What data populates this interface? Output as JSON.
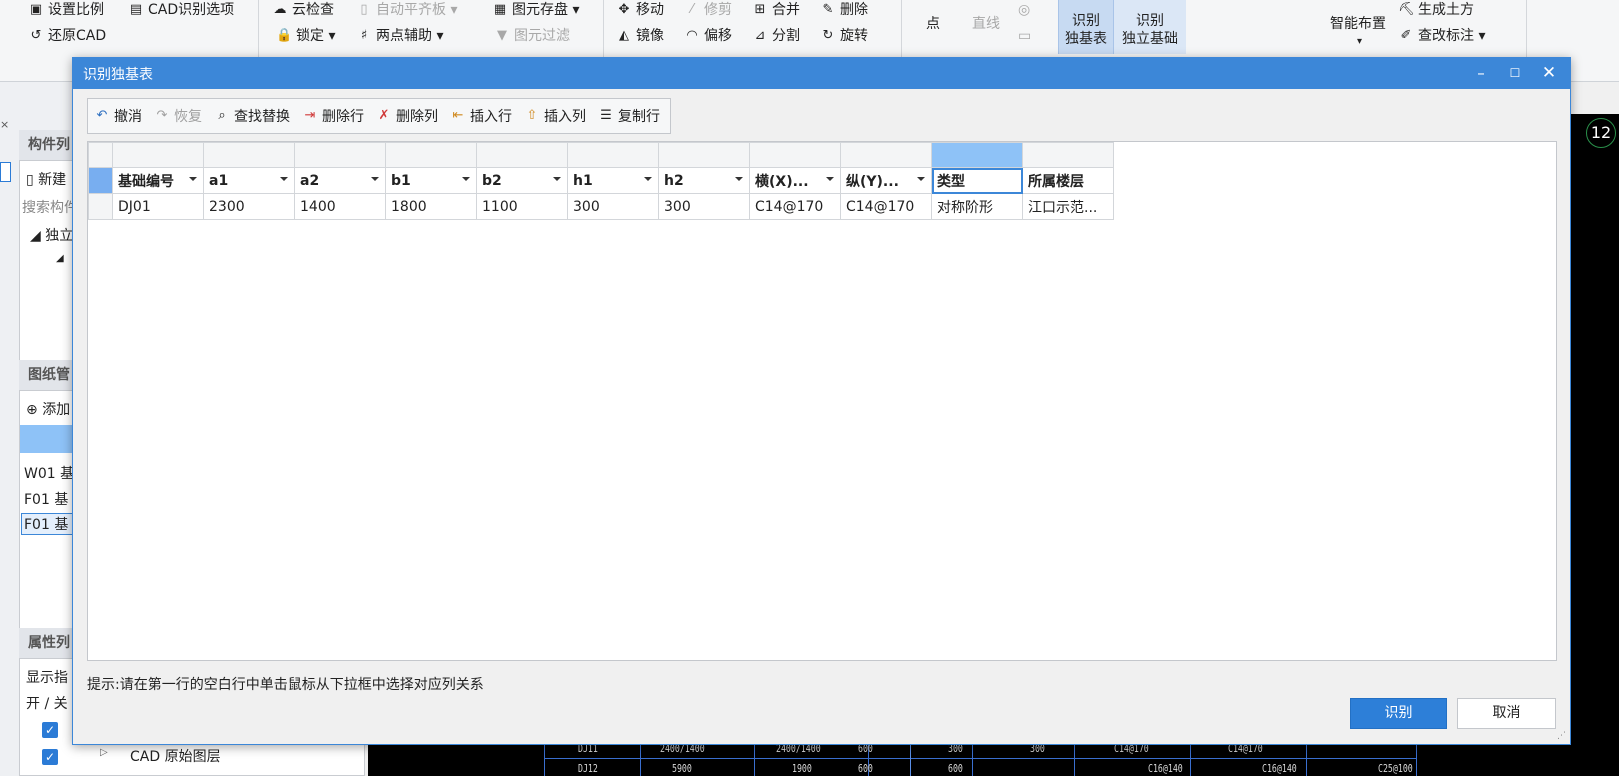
{
  "ribbon": {
    "set_scale": "设置比例",
    "cad_options": "CAD识别选项",
    "restore_cad": "还原CAD",
    "cloud_check": "云检查",
    "auto_level_slab": "自动平齐板",
    "lock": "锁定",
    "two_point_axis": "两点辅助",
    "save_element": "图元存盘",
    "filter_element": "图元过滤",
    "move": "移动",
    "trim": "修剪",
    "merge": "合并",
    "delete": "删除",
    "mirror": "镜像",
    "offset": "偏移",
    "split": "分割",
    "rotate": "旋转",
    "point": "点",
    "line": "直线",
    "identify_table_l1": "识别",
    "identify_table_l2": "独基表",
    "identify_found_l1": "识别",
    "identify_found_l2": "独立基础",
    "smart_layout": "智能布置",
    "gen_earthwork": "生成土方",
    "edit_annotation": "查改标注"
  },
  "left_panel": {
    "component_list": "构件列",
    "new": "新建",
    "search": "搜索构件",
    "tree_root": "独立",
    "drawing_mgmt": "图纸管",
    "add": "添加",
    "drawings": [
      "W01 基",
      "F01 基",
      "F01 基"
    ],
    "property_list": "属性列",
    "show": "显示指",
    "toggle": "开 / 关",
    "cad_layer": "CAD 原始图层"
  },
  "canvas": {
    "badge": "12",
    "row1": [
      "DJ11",
      "2400/1400",
      "2400/1400",
      "600",
      "300",
      "300",
      "C14@170",
      "C14@170"
    ],
    "row2": [
      "DJ12",
      "5900",
      "1900",
      "600",
      "600",
      "C16@140",
      "C16@140",
      "C25@100"
    ]
  },
  "dialog": {
    "title": "识别独基表",
    "toolbar": {
      "undo": "撤消",
      "redo": "恢复",
      "find_replace": "查找替换",
      "delete_row": "删除行",
      "delete_col": "删除列",
      "insert_row": "插入行",
      "insert_col": "插入列",
      "copy_row": "复制行"
    },
    "columns": [
      "基础编号",
      "a1",
      "a2",
      "b1",
      "b2",
      "h1",
      "h2",
      "横(X)...",
      "纵(Y)...",
      "类型",
      "所属楼层"
    ],
    "rows": [
      [
        "DJ01",
        "2300",
        "1400",
        "1800",
        "1100",
        "300",
        "300",
        "C14@170",
        "C14@170",
        "对称阶形",
        "江口示范..."
      ]
    ],
    "hint": "提示:请在第一行的空白行中单击鼠标从下拉框中选择对应列关系",
    "ok": "识别",
    "cancel": "取消"
  },
  "colors": {
    "accent": "#3c87d8",
    "selected_header": "#8ec2f7"
  }
}
